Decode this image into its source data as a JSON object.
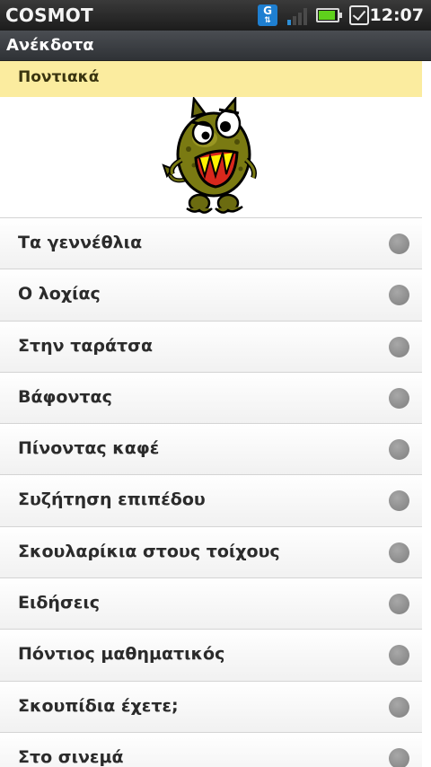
{
  "status_bar": {
    "carrier": "COSMOT",
    "network_icon": "g-data-icon",
    "network_letter": "G",
    "signal_icon": "signal-icon",
    "battery_icon": "battery-icon",
    "checkbox_icon": "task-checkbox-icon",
    "time": "12:07"
  },
  "title_bar": {
    "title": "Ανέκδοτα"
  },
  "category": {
    "label": "Ποντιακά",
    "image": "monster-mascot-image"
  },
  "list": {
    "items": [
      {
        "label": "Τα γεννέθλια"
      },
      {
        "label": "Ο λοχίας"
      },
      {
        "label": "Στην ταράτσα"
      },
      {
        "label": "Βάφοντας"
      },
      {
        "label": "Πίνοντας καφέ"
      },
      {
        "label": "Συζήτηση επιπέδου"
      },
      {
        "label": "Σκουλαρίκια στους τοίχους"
      },
      {
        "label": "Ειδήσεις"
      },
      {
        "label": "Πόντιος μαθηματικός"
      },
      {
        "label": "Σκουπίδια έχετε;"
      },
      {
        "label": "Στο σινεμά"
      }
    ],
    "indicator_icon": "unread-dot-icon"
  },
  "colors": {
    "category_bg": "#fbec9f",
    "status_bg": "#1c1c1c",
    "title_bg": "#3a3d42",
    "dot": "#8e8e8e"
  }
}
